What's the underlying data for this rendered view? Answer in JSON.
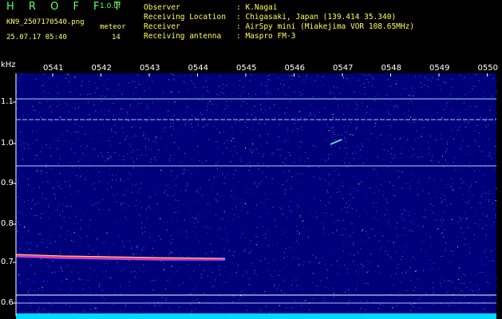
{
  "header": {
    "app_name": "H R O F F T",
    "version": "1.0.0f",
    "filename": "KN9_2507170540.png",
    "datetime": "25.07.17 05:40",
    "detection_label": "meteor",
    "detection_count": "14",
    "fields": [
      {
        "label": "Observer",
        "value": ": K.Nagai"
      },
      {
        "label": "Receiving Location",
        "value": ": Chigasaki, Japan (139.414 35.340)"
      },
      {
        "label": "Receiver",
        "value": ": AirSpy mini (Miakejima VOR 108.65MHz)"
      },
      {
        "label": "Receiving antenna",
        "value": ": Maspro FM-3"
      }
    ]
  },
  "spectrogram": {
    "y_unit": "kHz",
    "y_ticks": [
      "1.1",
      "1.0",
      "0.9",
      "0.8",
      "0.7",
      "0.6"
    ],
    "x_ticks": [
      "0541",
      "0542",
      "0543",
      "0544",
      "0545",
      "0546",
      "0547",
      "0548",
      "0549",
      "0550"
    ],
    "colors": {
      "background": "#00007a",
      "noise": "#3a5cff",
      "line": "#b8d8ff",
      "bottom_band": "#00d8ff"
    }
  }
}
